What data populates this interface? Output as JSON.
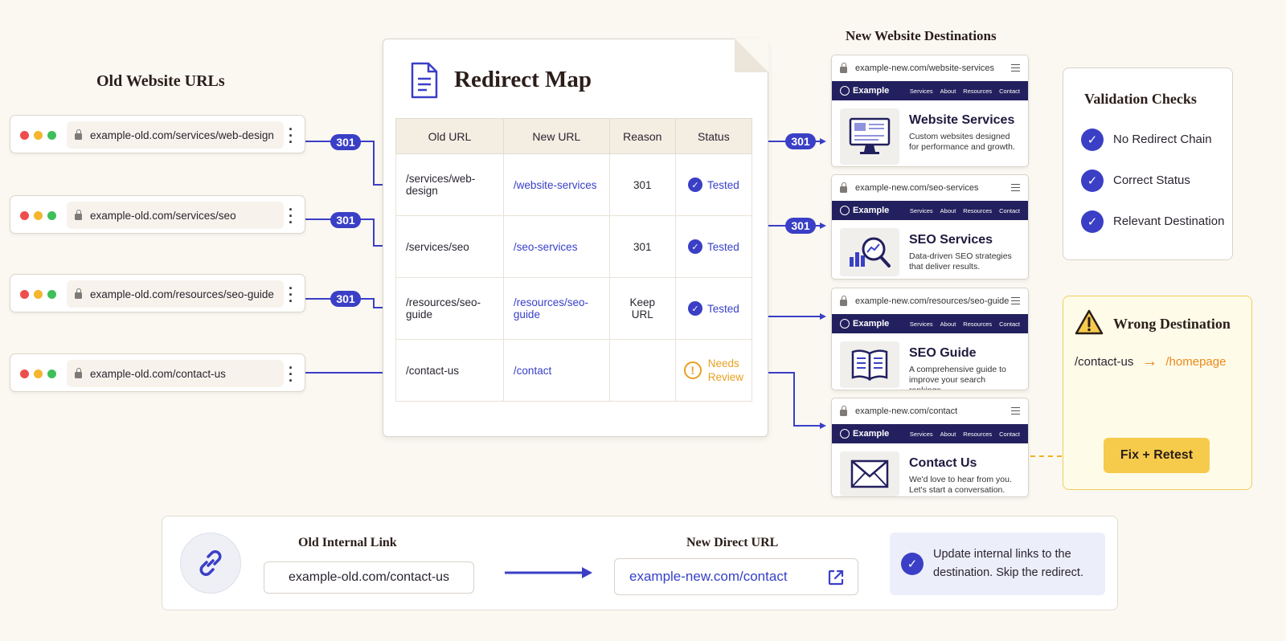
{
  "headings": {
    "old": "Old Website URLs",
    "new": "New Website Destinations"
  },
  "old_urls": [
    {
      "address": "example-old.com/services/web-design",
      "redirect": "301"
    },
    {
      "address": "example-old.com/services/seo",
      "redirect": "301"
    },
    {
      "address": "example-old.com/resources/seo-guide",
      "redirect": "301"
    },
    {
      "address": "example-old.com/contact-us",
      "redirect": ""
    }
  ],
  "redirect_map": {
    "title": "Redirect Map",
    "columns": [
      "Old URL",
      "New URL",
      "Reason",
      "Status"
    ],
    "rows": [
      {
        "old": "/services/web-design",
        "new": "/website-services",
        "reason": "301",
        "status": "Tested"
      },
      {
        "old": "/services/seo",
        "new": "/seo-services",
        "reason": "301",
        "status": "Tested"
      },
      {
        "old": "/resources/seo-guide",
        "new": "/resources/seo-guide",
        "reason": "Keep URL",
        "status": "Tested"
      },
      {
        "old": "/contact-us",
        "new": "/contact",
        "reason": "",
        "status_line1": "Needs",
        "status_line2": "Review"
      }
    ]
  },
  "destinations": [
    {
      "url": "example-new.com/website-services",
      "badge": "301",
      "title": "Website Services",
      "desc": "Custom websites designed for performance and growth.",
      "icon": "monitor-icon"
    },
    {
      "url": "example-new.com/seo-services",
      "badge": "301",
      "title": "SEO Services",
      "desc": "Data-driven SEO strategies that deliver results.",
      "icon": "magnifier-chart-icon"
    },
    {
      "url": "example-new.com/resources/seo-guide",
      "badge": "",
      "title": "SEO Guide",
      "desc": "A comprehensive guide to improve your search rankings.",
      "icon": "book-icon"
    },
    {
      "url": "example-new.com/contact",
      "badge": "",
      "title": "Contact Us",
      "desc": "We'd love to hear from you. Let's start a conversation.",
      "icon": "envelope-icon"
    }
  ],
  "site_nav": {
    "brand": "Example",
    "links": [
      "Services",
      "About",
      "Resources",
      "Contact"
    ]
  },
  "validation": {
    "title": "Validation Checks",
    "items": [
      "No Redirect Chain",
      "Correct Status",
      "Relevant Destination"
    ]
  },
  "wrong_destination": {
    "title": "Wrong Destination",
    "from": "/contact-us",
    "arrow": "→",
    "to": "/homepage",
    "button": "Fix + Retest"
  },
  "internal_links": {
    "old_title": "Old Internal Link",
    "old_value": "example-old.com/contact-us",
    "new_title": "New Direct URL",
    "new_value": "example-new.com/contact",
    "tip": "Update internal links to the destination.  Skip the redirect."
  },
  "colors": {
    "accent": "#3a3fc6",
    "nav": "#22205e",
    "warning": "#e8a020",
    "button": "#f6cb4c"
  }
}
